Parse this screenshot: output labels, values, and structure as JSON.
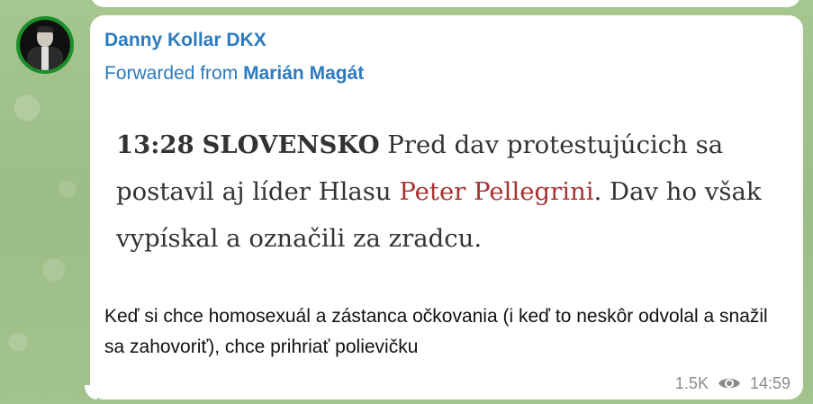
{
  "message": {
    "sender": "Danny Kollar DKX",
    "forwarded_prefix": "Forwarded from",
    "forwarded_from": "Marián Magát",
    "article": {
      "time": "13:28",
      "country": "SLOVENSKO",
      "text_before": "Pred dav protestujúcich sa postavil aj líder Hlasu",
      "person": "Peter Pellegrini",
      "text_after": ". Dav ho však vypískal a označili za zradcu."
    },
    "caption": "Keď si chce homosexuál a zástanca očkovania (i keď to neskôr odvolal a snažil sa zahovoriť), chce prihriať polievičku",
    "views": "1.5K",
    "time": "14:59"
  },
  "colors": {
    "accent": "#2b7bc0",
    "highlight": "#a63232",
    "background": "#9fc08a",
    "avatar_ring": "#1b8f2a"
  },
  "icons": {
    "views": "eye-icon"
  }
}
